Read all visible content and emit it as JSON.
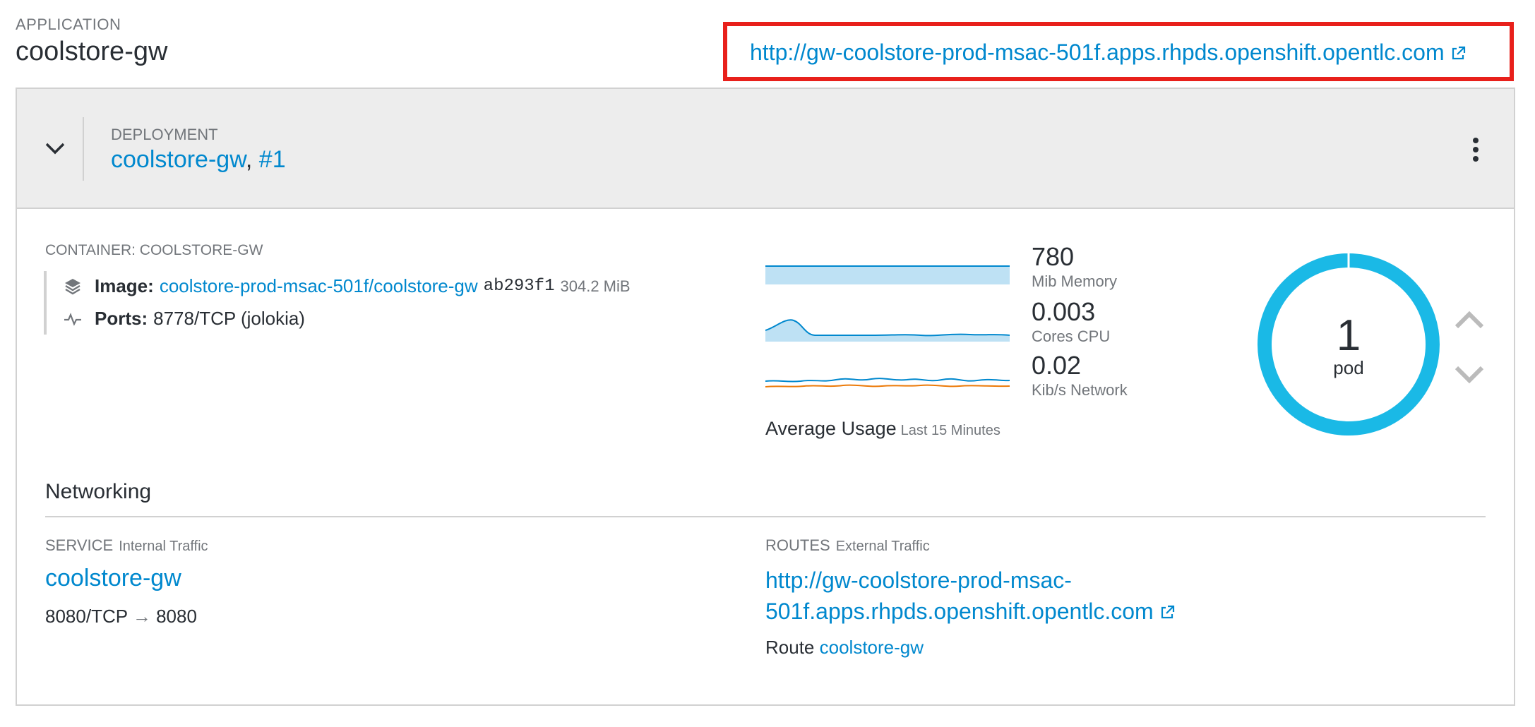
{
  "application": {
    "label": "APPLICATION",
    "name": "coolstore-gw",
    "route_url": "http://gw-coolstore-prod-msac-501f.apps.rhpds.openshift.opentlc.com"
  },
  "deployment": {
    "label": "DEPLOYMENT",
    "name": "coolstore-gw",
    "separator": ",",
    "revision": "#1"
  },
  "container": {
    "label": "CONTAINER: COOLSTORE-GW",
    "image_label": "Image:",
    "image_link": "coolstore-prod-msac-501f/coolstore-gw",
    "image_hash": "ab293f1",
    "image_size": "304.2 MiB",
    "ports_label": "Ports:",
    "ports_value": "8778/TCP (jolokia)"
  },
  "metrics": {
    "memory": {
      "value": "780",
      "label": "Mib Memory"
    },
    "cpu": {
      "value": "0.003",
      "label": "Cores CPU"
    },
    "network": {
      "value": "0.02",
      "label": "Kib/s Network"
    },
    "avg_label": "Average Usage",
    "avg_sub": "Last 15 Minutes",
    "colors": {
      "line": "#0088ce",
      "fill": "#bee1f4",
      "orange": "#ec7a08"
    }
  },
  "pods": {
    "count": "1",
    "label": "pod",
    "ring_color": "#1ab9e6"
  },
  "networking": {
    "title": "Networking",
    "service_label": "SERVICE",
    "service_sub": "Internal Traffic",
    "service_name": "coolstore-gw",
    "service_port_from": "8080/TCP",
    "service_arrow": "→",
    "service_port_to": "8080",
    "routes_label": "ROUTES",
    "routes_sub": "External Traffic",
    "route_url_line1": "http://gw-coolstore-prod-msac-",
    "route_url_line2": "501f.apps.rhpds.openshift.opentlc.com",
    "route_prefix": "Route",
    "route_name": "coolstore-gw"
  },
  "icons": {
    "external_link": "external-link-icon",
    "toggle": "chevron-down-icon",
    "kebab": "kebab-icon",
    "image": "layers-icon",
    "ports": "pulse-icon",
    "scale_up": "chevron-up-icon",
    "scale_down": "chevron-down-icon"
  },
  "highlight_color": "#e8201b"
}
